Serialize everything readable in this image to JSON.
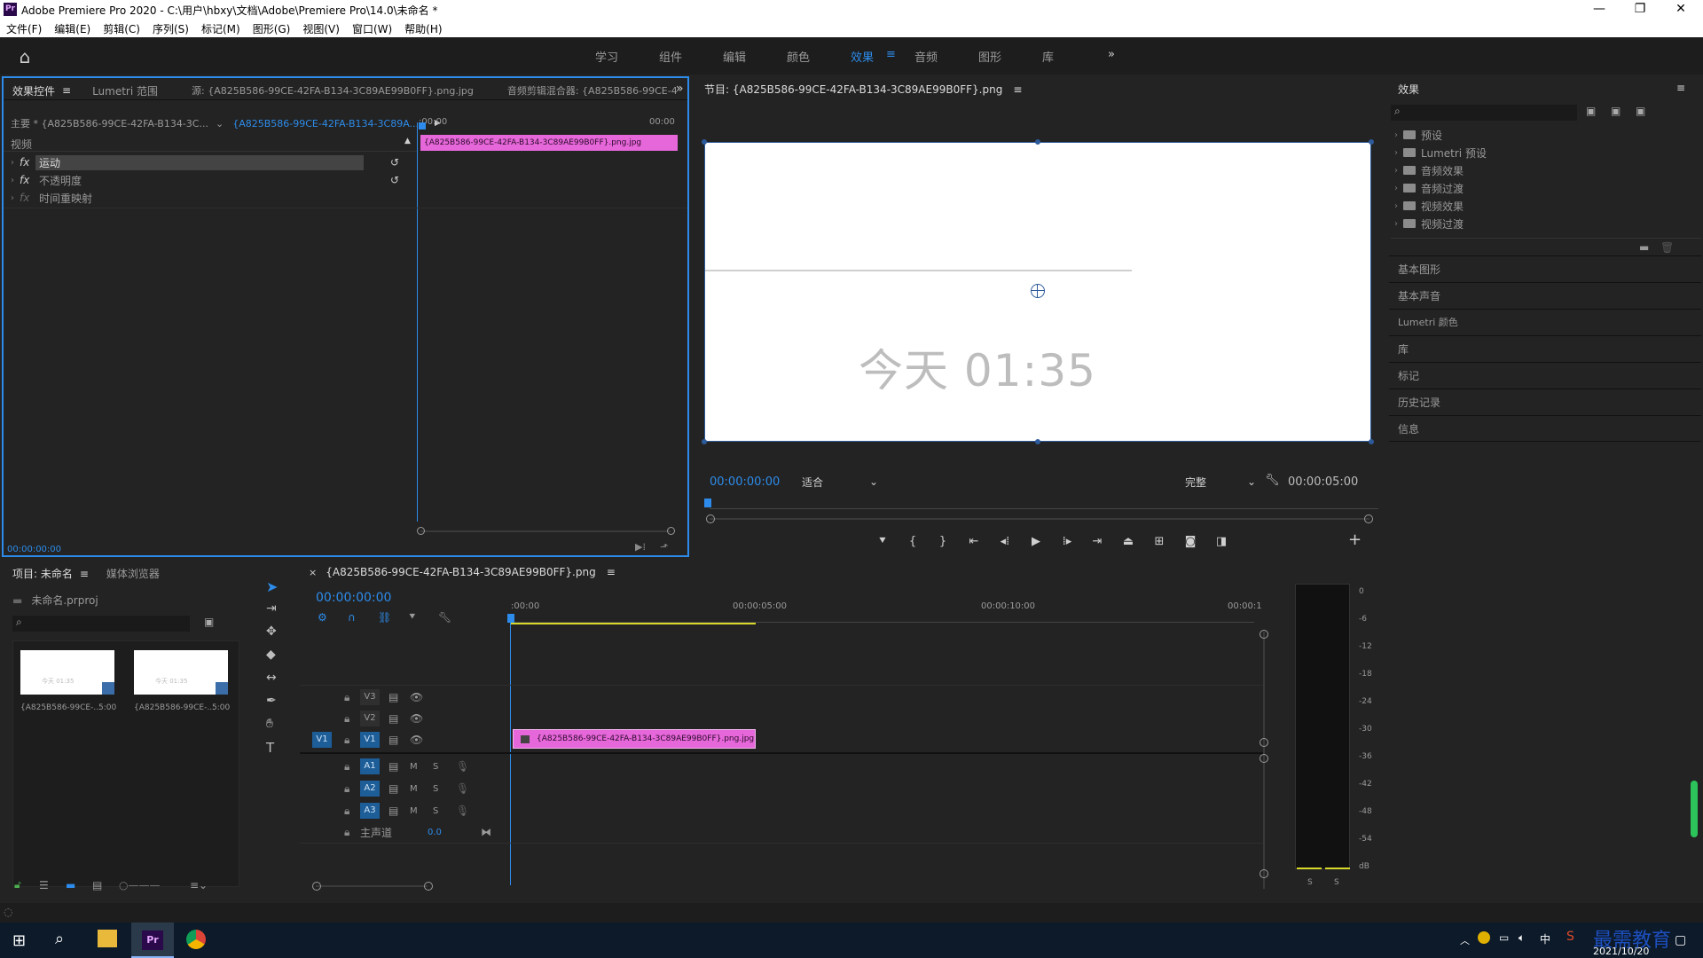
{
  "title_bar": {
    "app_icon": "Pr",
    "title": "Adobe Premiere Pro 2020 - C:\\用户\\hbxy\\文档\\Adobe\\Premiere Pro\\14.0\\未命名 *"
  },
  "menu": [
    "文件(F)",
    "编辑(E)",
    "剪辑(C)",
    "序列(S)",
    "标记(M)",
    "图形(G)",
    "视图(V)",
    "窗口(W)",
    "帮助(H)"
  ],
  "workspaces": [
    "学习",
    "组件",
    "编辑",
    "颜色",
    "效果",
    "音频",
    "图形",
    "库"
  ],
  "active_workspace": "效果",
  "effect_controls": {
    "tabs": [
      "效果控件",
      "Lumetri 范围",
      "源: {A825B586-99CE-42FA-B134-3C89AE99B0FF}.png.jpg",
      "音频剪辑混合器: {A825B586-99CE-4"
    ],
    "master": "主要 * {A825B586-99CE-42FA-B134-3C...",
    "clip": "{A825B586-99CE-42FA-B134-3C89A...",
    "time_start": ":00:00",
    "time_end": "00:00",
    "section": "视频",
    "effects": [
      "运动",
      "不透明度",
      "时间重映射"
    ],
    "clip_bar": "{A825B586-99CE-42FA-B134-3C89AE99B0FF}.png.jpg",
    "timecode": "00:00:00:00"
  },
  "program_monitor": {
    "title": "节目: {A825B586-99CE-42FA-B134-3C89AE99B0FF}.png",
    "frame_text": "今天 01:35",
    "timecode": "00:00:00:00",
    "fit": "适合",
    "quality": "完整",
    "duration": "00:00:05:00"
  },
  "effects_panel": {
    "title": "效果",
    "folders": [
      "预设",
      "Lumetri 预设",
      "音频效果",
      "音频过渡",
      "视频效果",
      "视频过渡"
    ],
    "sections": [
      "基本图形",
      "基本声音",
      "Lumetri 颜色",
      "库",
      "标记",
      "历史记录",
      "信息"
    ]
  },
  "project": {
    "tabs": [
      "项目: 未命名",
      "媒体浏览器"
    ],
    "file": "未命名.prproj",
    "items": [
      {
        "name": "{A825B586-99CE-...",
        "duration": "5:00",
        "thumb": "今天 01:35"
      },
      {
        "name": "{A825B586-99CE-...",
        "duration": "5:00",
        "thumb": "今天 01:35"
      }
    ]
  },
  "timeline": {
    "tab": "{A825B586-99CE-42FA-B134-3C89AE99B0FF}.png",
    "timecode": "00:00:00:00",
    "ruler": [
      ":00:00",
      "00:00:05:00",
      "00:00:10:00",
      "00:00:1"
    ],
    "video_tracks": [
      "V3",
      "V2",
      "V1"
    ],
    "audio_tracks": [
      "A1",
      "A2",
      "A3"
    ],
    "source_patch": "V1",
    "master": "主声道",
    "master_value": "0.0",
    "clip": "{A825B586-99CE-42FA-B134-3C89AE99B0FF}.png.jpg",
    "m": "M",
    "s": "S"
  },
  "meter": {
    "scale": [
      "0",
      "-6",
      "-12",
      "-18",
      "-24",
      "-30",
      "-36",
      "-42",
      "-48",
      "-54",
      "dB"
    ],
    "solo": [
      "S",
      "S"
    ]
  },
  "taskbar": {
    "ime": "中",
    "clock_date": "2021/10/20",
    "watermark": "最需教育"
  },
  "colors": {
    "accent": "#2d8ceb",
    "clip": "#e667d9",
    "panel": "#232323"
  }
}
